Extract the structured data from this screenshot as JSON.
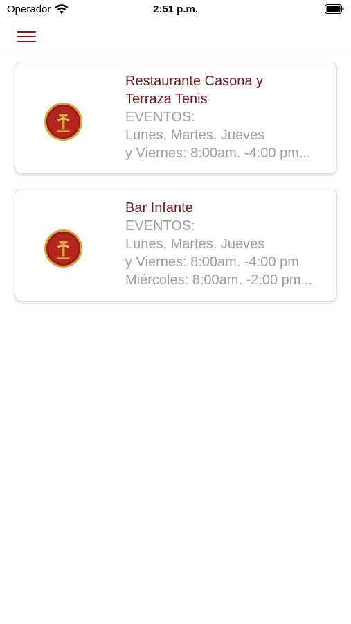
{
  "status_bar": {
    "carrier": "Operador",
    "time": "2:51 p.m."
  },
  "colors": {
    "accent": "#6e1a1a",
    "muted_text": "#9e9e9e",
    "logo_gold": "#d4a83a",
    "logo_red": "#9b1b1b"
  },
  "icons": {
    "menu": "hamburger-menu-icon",
    "wifi": "wifi-icon",
    "battery": "battery-icon",
    "logo": "restaurant-logo-icon"
  },
  "venues": [
    {
      "title_line1": "Restaurante Casona y",
      "title_line2": "Terraza Tenis",
      "events_label": "EVENTOS:",
      "line1": "Lunes, Martes, Jueves",
      "line2": "y Viernes: 8:00am. -4:00 pm..."
    },
    {
      "title_line1": "Bar Infante",
      "events_label": "EVENTOS:",
      "line1": "Lunes, Martes, Jueves",
      "line2": "y Viernes: 8:00am. -4:00 pm",
      "line3": "Miércoles: 8:00am. -2:00 pm..."
    }
  ]
}
